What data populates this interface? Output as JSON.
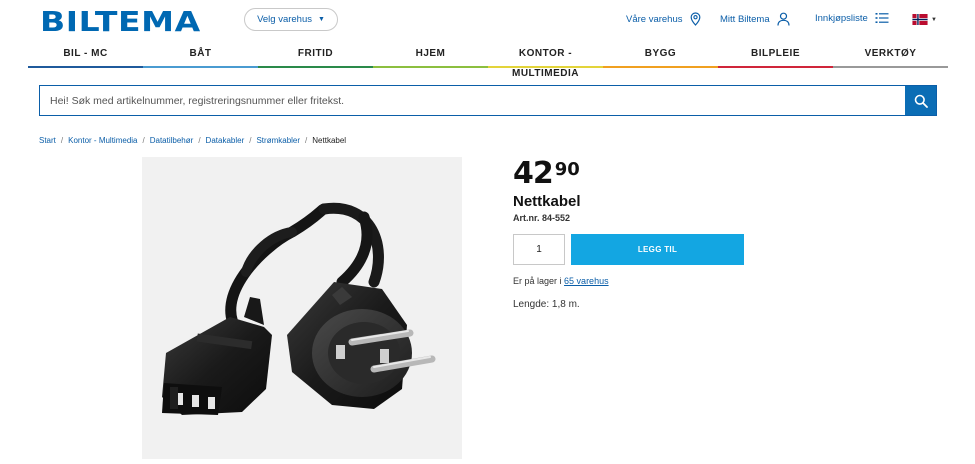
{
  "header": {
    "logo_text": "BILTEMA",
    "store_select_label": "Velg varehus",
    "links": {
      "stores": "Våre varehus",
      "account": "Mitt Biltema",
      "shopping_list": "Innkjøpsliste"
    },
    "language_flag": "norway-flag-icon"
  },
  "categories": [
    {
      "label": "BIL - MC",
      "color": "#1f5a9c"
    },
    {
      "label": "BÅT",
      "color": "#4a9bd1"
    },
    {
      "label": "FRITID",
      "color": "#2a8a4a"
    },
    {
      "label": "HJEM",
      "color": "#8cbf3f"
    },
    {
      "label": "KONTOR - MULTIMEDIA",
      "color": "#e3d43a"
    },
    {
      "label": "BYGG",
      "color": "#f0a020"
    },
    {
      "label": "BILPLEIE",
      "color": "#d0253a"
    },
    {
      "label": "VERKTØY",
      "color": "#999999"
    }
  ],
  "search": {
    "placeholder": "Hei! Søk med artikelnummer, registreringsnummer eller fritekst.",
    "value": ""
  },
  "breadcrumb": {
    "items": [
      "Start",
      "Kontor - Multimedia",
      "Datatilbehør",
      "Datakabler",
      "Strømkabler"
    ],
    "current": "Nettkabel"
  },
  "product": {
    "price_kr": "42",
    "price_ore": "90",
    "name": "Nettkabel",
    "article_number": "Art.nr. 84-552",
    "quantity": "1",
    "add_button_label": "LEGG TIL",
    "stock_prefix": "Er på lager i",
    "stock_link": "65 varehus",
    "description": "Lengde: 1,8 m."
  },
  "colors": {
    "brand_blue": "#0068b2",
    "link_blue": "#0b5ea8",
    "add_button": "#13a6e2"
  }
}
